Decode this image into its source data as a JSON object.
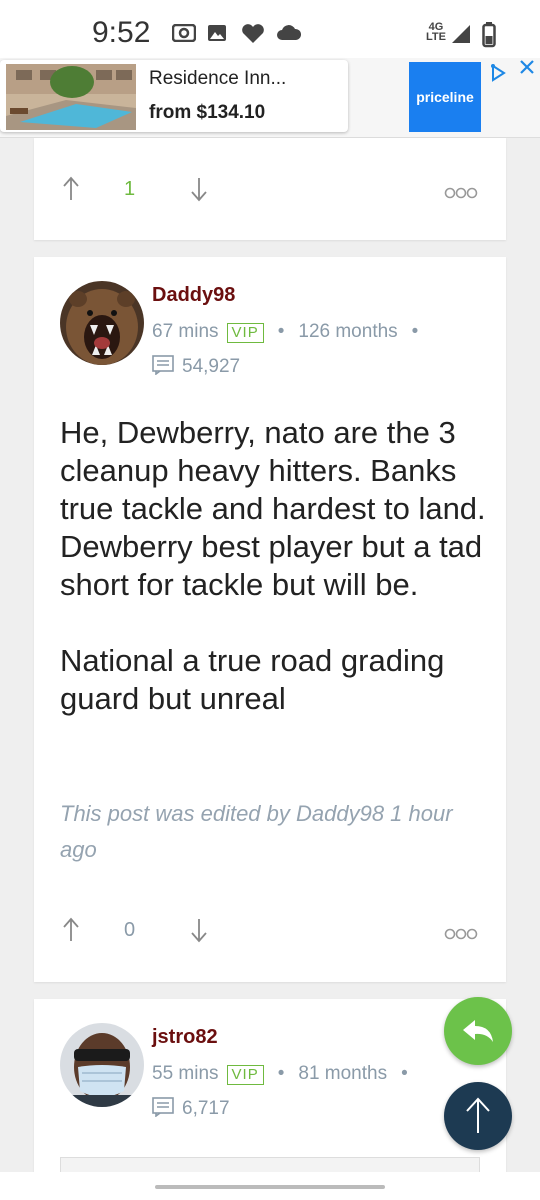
{
  "status_bar": {
    "time": "9:52",
    "network": "4G",
    "network_sub": "LTE",
    "icons": [
      "radio-icon",
      "image-icon",
      "heart-icon",
      "cloud-icon",
      "signal-icon",
      "battery-icon"
    ]
  },
  "ad": {
    "title": "Residence Inn...",
    "price": "from $134.10",
    "brand": "priceline",
    "brand_color": "#1a7ff0"
  },
  "posts": [
    {
      "votes": "1",
      "vote_color": "#6fba3f"
    },
    {
      "username": "Daddy98",
      "time_ago": "67 mins",
      "badge": "VIP",
      "membership": "126 months",
      "post_count": "54,927",
      "paragraphs": [
        "He, Dewberry, nato are the 3 cleanup heavy hitters. Banks true tackle and hardest to land. Dewberry best player but a tad short for tackle but will be.",
        "National a true road grading guard but unreal"
      ],
      "edited_note": "This post was edited by Daddy98 1 hour ago",
      "votes": "0"
    },
    {
      "username": "jstro82",
      "time_ago": "55 mins",
      "badge": "VIP",
      "membership": "81 months",
      "post_count": "6,717"
    }
  ],
  "colors": {
    "username": "#6b0f0f",
    "meta": "#8a9aa8",
    "vip": "#6fba3f",
    "reply_fab": "#6cc24a",
    "top_fab": "#1d3a52"
  }
}
